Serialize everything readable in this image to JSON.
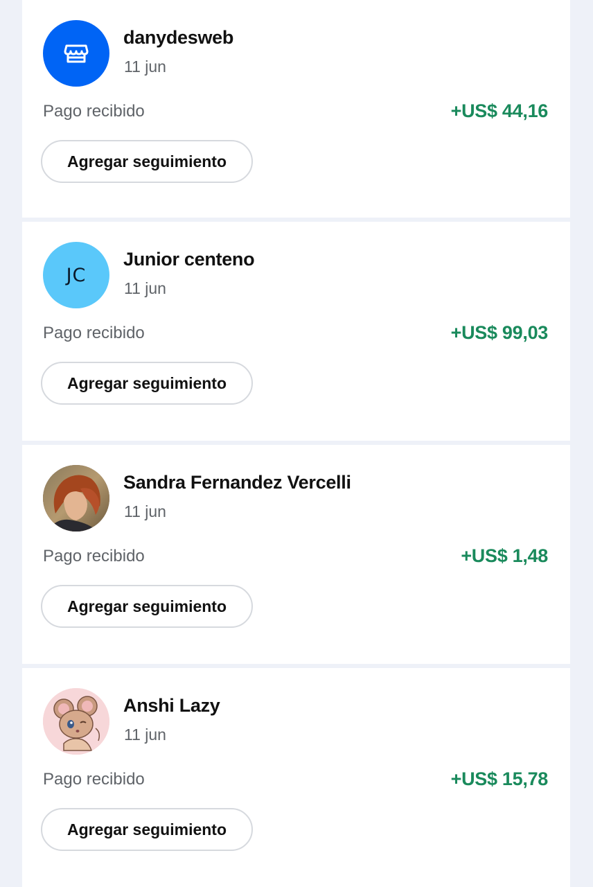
{
  "transactions": [
    {
      "name": "danydesweb",
      "date": "11 jun",
      "status": "Pago recibido",
      "amount": "+US$ 44,16",
      "action_label": "Agregar seguimiento",
      "avatar_type": "store-icon",
      "avatar_color": "#0064f5"
    },
    {
      "name": "Junior centeno",
      "date": "11 jun",
      "status": "Pago recibido",
      "amount": "+US$ 99,03",
      "action_label": "Agregar seguimiento",
      "avatar_type": "initials",
      "avatar_initials": "JC",
      "avatar_color": "#5ac8fa"
    },
    {
      "name": "Sandra Fernandez Vercelli",
      "date": "11 jun",
      "status": "Pago recibido",
      "amount": "+US$ 1,48",
      "action_label": "Agregar seguimiento",
      "avatar_type": "profile-photo"
    },
    {
      "name": "Anshi Lazy",
      "date": "11 jun",
      "status": "Pago recibido",
      "amount": "+US$ 15,78",
      "action_label": "Agregar seguimiento",
      "avatar_type": "cartoon-mouse-avatar"
    }
  ],
  "colors": {
    "amount_positive": "#1a8a5c",
    "background": "#eef1f8",
    "card": "#ffffff"
  }
}
